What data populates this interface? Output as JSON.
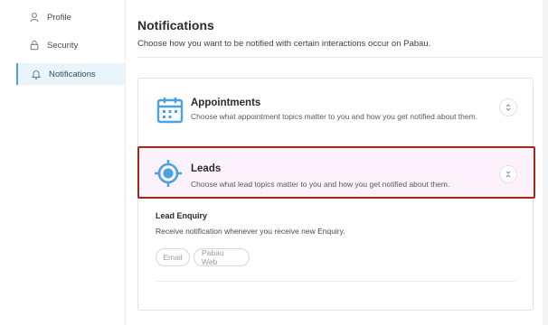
{
  "sidebar": {
    "items": [
      {
        "label": "Profile",
        "icon": "user-icon"
      },
      {
        "label": "Security",
        "icon": "lock-icon"
      },
      {
        "label": "Notifications",
        "icon": "bell-icon",
        "active": true
      }
    ]
  },
  "main": {
    "title": "Notifications",
    "subtitle": "Choose how you want to be notified with certain interactions occur on Pabau."
  },
  "cards": {
    "appointments": {
      "title": "Appointments",
      "description": "Choose what appointment topics matter to you and how you get notified about them.",
      "icon": "calendar-icon"
    },
    "leads": {
      "title": "Leads",
      "description": "Choose what lead topics matter to you and how you get notified about them.",
      "icon": "target-icon"
    }
  },
  "lead_enquiry": {
    "title": "Lead Enquiry",
    "description": "Receive notification whenever you receive new Enquiry.",
    "channels": [
      "Email",
      "Pabau Web"
    ]
  },
  "colors": {
    "accent": "#4aa3df",
    "highlight_border": "#9e2a17",
    "active_bg": "#eaf4fb"
  }
}
